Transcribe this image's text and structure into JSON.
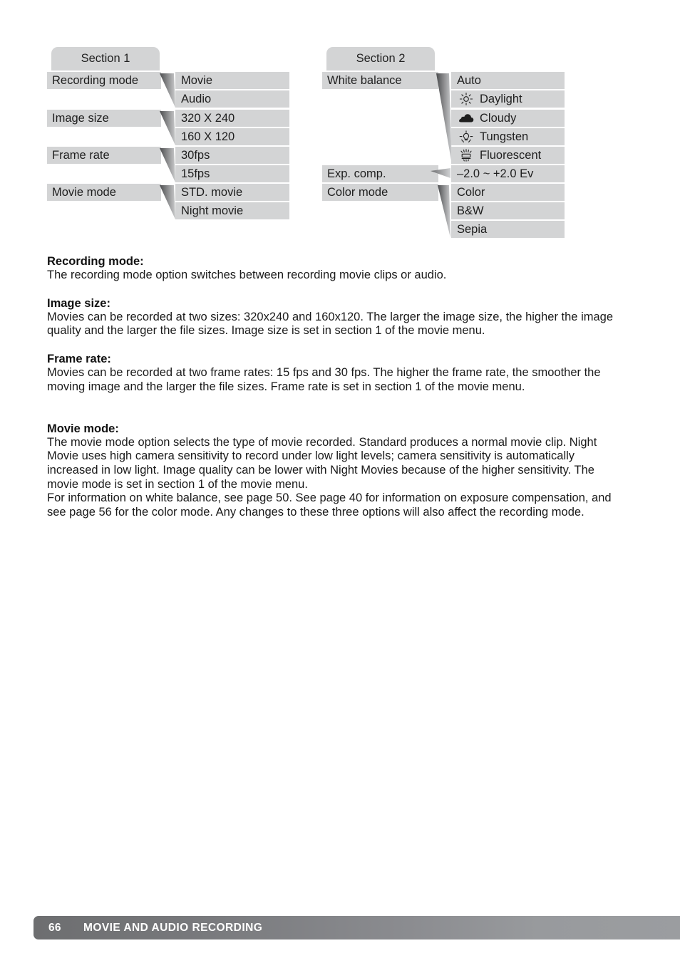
{
  "menu_diagram": {
    "section_1": {
      "tab_label": "Section 1",
      "rows": [
        {
          "label": "Recording mode",
          "options": [
            "Movie",
            "Audio"
          ]
        },
        {
          "label": "Image size",
          "options": [
            "320 X 240",
            "160 X 120"
          ]
        },
        {
          "label": "Frame rate",
          "options": [
            "30fps",
            "15fps"
          ]
        },
        {
          "label": "Movie mode",
          "options": [
            "STD. movie",
            "Night movie"
          ]
        }
      ]
    },
    "section_2": {
      "tab_label": "Section 2",
      "rows": [
        {
          "label": "White balance",
          "options": [
            "Auto",
            "Daylight",
            "Cloudy",
            "Tungsten",
            "Fluorescent"
          ],
          "option_icons": [
            "none",
            "sun-icon",
            "cloud-icon",
            "lightbulb-icon",
            "fluorescent-tube-icon"
          ]
        },
        {
          "label": "Exp. comp.",
          "options": [
            "–2.0 ~ +2.0 Ev"
          ],
          "option_icons": [
            "none"
          ]
        },
        {
          "label": "Color mode",
          "options": [
            "Color",
            "B&W",
            "Sepia"
          ],
          "option_icons": [
            "none",
            "none",
            "none"
          ]
        }
      ]
    },
    "box_color": "#d3d4d5",
    "wedge_color": "#58595b"
  },
  "article": {
    "sections": [
      {
        "heading": "Recording mode:",
        "body": "The recording mode option switches between recording movie clips or audio."
      },
      {
        "heading": "Image size:",
        "body": "Movies can be recorded at two sizes: 320x240 and 160x120. The larger the image size, the higher the image quality and the larger the file sizes. Image size is set in section 1 of the movie menu."
      },
      {
        "heading": "Frame rate:",
        "body": "Movies can be recorded at two frame rates: 15 fps and 30 fps. The higher the frame rate, the smoother the moving image and the larger the file sizes. Frame rate is set in section 1 of the movie menu."
      },
      {
        "heading": "Movie mode:",
        "body": "The movie mode option selects the type of movie recorded. Standard produces a normal movie clip. Night Movie uses high camera sensitivity to record under low light levels; camera sensitivity is automatically increased in low light. Image quality can be lower with Night Movies because of the higher sensitivity. The movie mode is set in section 1 of the movie menu.",
        "body2": "For information on white balance, see page 50. See page 40 for information on exposure compensation, and see page 56 for the color mode. Any changes to these three options will also affect the recording mode."
      }
    ]
  },
  "footer": {
    "page_number": "66",
    "title": "MOVIE AND AUDIO RECORDING",
    "gradient_start": "#6d6e70",
    "gradient_end": "#9b9da0"
  }
}
